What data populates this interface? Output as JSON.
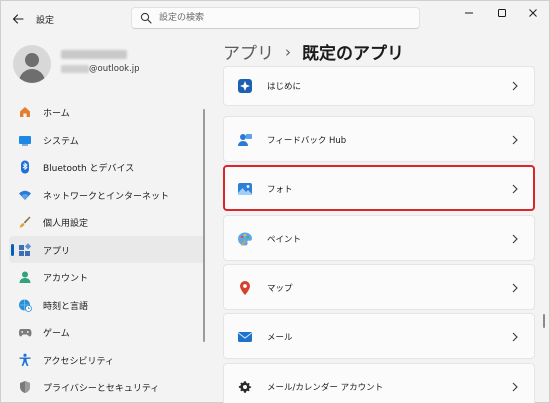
{
  "titlebar": {
    "app_title": "設定",
    "search_placeholder": "設定の検索"
  },
  "profile": {
    "email_suffix": "@outlook.jp"
  },
  "sidebar": {
    "items": [
      {
        "label": "ホーム",
        "icon": "home-icon",
        "selected": false
      },
      {
        "label": "システム",
        "icon": "system-monitor-icon",
        "selected": false
      },
      {
        "label": "Bluetooth とデバイス",
        "icon": "bluetooth-icon",
        "selected": false
      },
      {
        "label": "ネットワークとインターネット",
        "icon": "wifi-icon",
        "selected": false
      },
      {
        "label": "個人用設定",
        "icon": "paintbrush-icon",
        "selected": false
      },
      {
        "label": "アプリ",
        "icon": "apps-icon",
        "selected": true
      },
      {
        "label": "アカウント",
        "icon": "person-icon",
        "selected": false
      },
      {
        "label": "時刻と言語",
        "icon": "globe-clock-icon",
        "selected": false
      },
      {
        "label": "ゲーム",
        "icon": "gamepad-icon",
        "selected": false
      },
      {
        "label": "アクセシビリティ",
        "icon": "accessibility-icon",
        "selected": false
      },
      {
        "label": "プライバシーとセキュリティ",
        "icon": "shield-icon",
        "selected": false
      }
    ]
  },
  "main": {
    "breadcrumb": {
      "parent": "アプリ",
      "separator": "›",
      "current": "既定のアプリ"
    },
    "apps": [
      {
        "label": "はじめに",
        "icon": "get-started-icon"
      },
      {
        "label": "フィードバック Hub",
        "icon": "feedback-hub-icon"
      },
      {
        "label": "フォト",
        "icon": "photos-icon",
        "highlighted": true
      },
      {
        "label": "ペイント",
        "icon": "paint-icon"
      },
      {
        "label": "マップ",
        "icon": "maps-pin-icon"
      },
      {
        "label": "メール",
        "icon": "mail-icon"
      },
      {
        "label": "メール/カレンダー アカウント",
        "icon": "gear-icon"
      }
    ]
  },
  "colors": {
    "accent": "#005fb8",
    "highlight_border": "#d9262b",
    "background": "#f3f3f3",
    "card": "#fbfbfb"
  }
}
